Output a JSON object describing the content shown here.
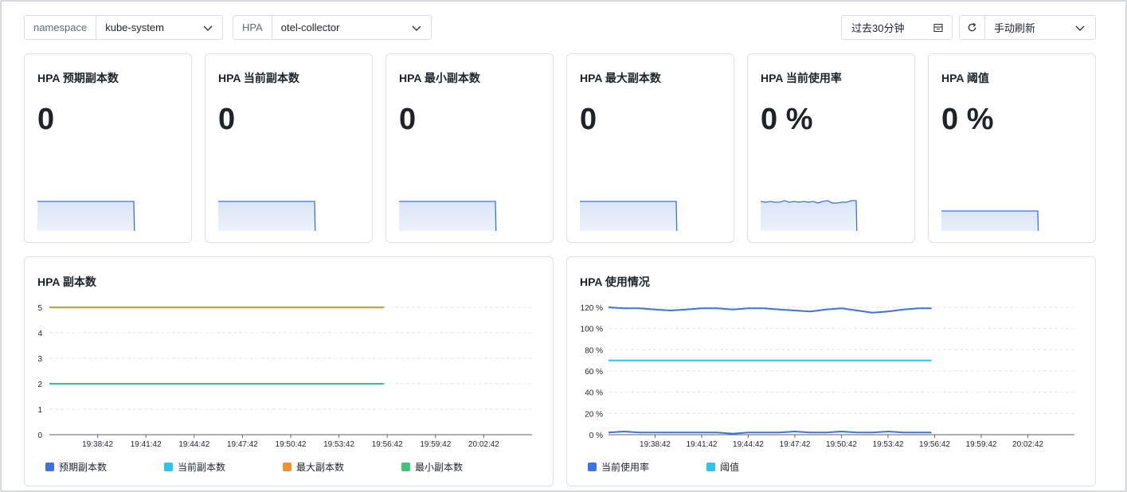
{
  "colors": {
    "blue": "#3b73e6",
    "cyan": "#29c5ed",
    "orange": "#f18f32",
    "green": "#3fc47a",
    "border": "#dee0e3"
  },
  "filters": {
    "namespace": {
      "label": "namespace",
      "value": "kube-system"
    },
    "hpa": {
      "label": "HPA",
      "value": "otel-collector"
    },
    "time_range": {
      "label": "过去30分钟",
      "icon": "calendar-icon"
    },
    "refresh": {
      "icon": "refresh-icon",
      "label": "手动刷新"
    }
  },
  "stats": [
    {
      "title": "HPA 预期副本数",
      "value": "0"
    },
    {
      "title": "HPA 当前副本数",
      "value": "0"
    },
    {
      "title": "HPA 最小副本数",
      "value": "0"
    },
    {
      "title": "HPA 最大副本数",
      "value": "0"
    },
    {
      "title": "HPA 当前使用率",
      "value": "0 %"
    },
    {
      "title": "HPA 阈值",
      "value": "0 %"
    }
  ],
  "panels": {
    "replicas": {
      "title": "HPA 副本数",
      "legend": [
        "预期副本数",
        "当前副本数",
        "最大副本数",
        "最小副本数"
      ]
    },
    "usage": {
      "title": "HPA 使用情况",
      "legend": [
        "当前使用率",
        "阈值"
      ]
    }
  },
  "chart_data": [
    {
      "type": "line",
      "title": "HPA 副本数",
      "x_ticks": [
        "19:38:42",
        "19:41:42",
        "19:44:42",
        "19:47:42",
        "19:50:42",
        "19:53:42",
        "19:56:42",
        "19:59:42",
        "20:02:42"
      ],
      "y_ticks": [
        "0",
        "1",
        "2",
        "3",
        "4",
        "5"
      ],
      "ylim": [
        0,
        5
      ],
      "xlim": [
        "19:35:42",
        "20:05:42"
      ],
      "grid": true,
      "legend_position": "bottom",
      "series": [
        {
          "name": "预期副本数",
          "color": "#3b73e6",
          "x": [],
          "values": []
        },
        {
          "name": "当前副本数",
          "color": "#29c5ed",
          "x": [],
          "values": []
        },
        {
          "name": "最大副本数",
          "color": "#f18f32",
          "x": [
            "19:35:42",
            "19:56:30"
          ],
          "values": [
            5,
            5
          ]
        },
        {
          "name": "最小副本数",
          "color": "#3fc47a",
          "x": [
            "19:35:42",
            "19:56:30"
          ],
          "values": [
            2,
            2
          ]
        }
      ]
    },
    {
      "type": "line",
      "title": "HPA 使用情况",
      "x_ticks": [
        "19:38:42",
        "19:41:42",
        "19:44:42",
        "19:47:42",
        "19:50:42",
        "19:53:42",
        "19:56:42",
        "19:59:42",
        "20:02:42"
      ],
      "y_ticks": [
        "0 %",
        "20 %",
        "40 %",
        "60 %",
        "80 %",
        "100 %",
        "120 %"
      ],
      "ylim": [
        0,
        120
      ],
      "xlim": [
        "19:35:42",
        "20:05:42"
      ],
      "grid": true,
      "legend_position": "bottom",
      "series": [
        {
          "name": "当前使用率",
          "color": "#3b73e6",
          "x": [
            "19:35:42",
            "19:36:42",
            "19:37:42",
            "19:38:42",
            "19:39:42",
            "19:40:42",
            "19:41:42",
            "19:42:42",
            "19:43:42",
            "19:44:42",
            "19:45:42",
            "19:46:42",
            "19:47:42",
            "19:48:42",
            "19:49:42",
            "19:50:42",
            "19:51:42",
            "19:52:42",
            "19:53:42",
            "19:54:42",
            "19:55:42",
            "19:56:30"
          ],
          "values": [
            120,
            119,
            119,
            118,
            117,
            118,
            119,
            119,
            118,
            119,
            119,
            118,
            117,
            116,
            118,
            119,
            117,
            115,
            116,
            118,
            119,
            119
          ]
        },
        {
          "name": "当前使用率",
          "color": "#3b73e6",
          "x": [
            "19:35:42",
            "19:36:42",
            "19:37:42",
            "19:38:42",
            "19:39:42",
            "19:40:42",
            "19:41:42",
            "19:42:42",
            "19:43:42",
            "19:44:42",
            "19:45:42",
            "19:46:42",
            "19:47:42",
            "19:48:42",
            "19:49:42",
            "19:50:42",
            "19:51:42",
            "19:52:42",
            "19:53:42",
            "19:54:42",
            "19:55:42",
            "19:56:30"
          ],
          "values": [
            2,
            3,
            2,
            2,
            2,
            2,
            2,
            2,
            1,
            2,
            2,
            2,
            3,
            2,
            2,
            3,
            2,
            2,
            3,
            2,
            2,
            2
          ]
        },
        {
          "name": "阈值",
          "color": "#29c5ed",
          "x": [
            "19:35:42",
            "19:56:30"
          ],
          "values": [
            70,
            70
          ]
        }
      ]
    }
  ]
}
